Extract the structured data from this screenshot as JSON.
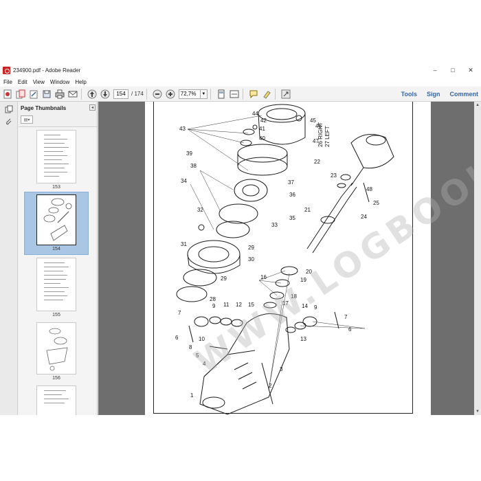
{
  "window": {
    "title": "234900.pdf - Adobe Reader",
    "controls": {
      "minimize": "–",
      "maximize": "□",
      "close": "✕"
    }
  },
  "menu": [
    "File",
    "Edit",
    "View",
    "Window",
    "Help"
  ],
  "toolbar": {
    "page_current": "154",
    "page_total": "/ 174",
    "zoom": "72,7%",
    "tabs": [
      "Tools",
      "Sign",
      "Comment"
    ]
  },
  "sidebar": {
    "title": "Page Thumbnails",
    "thumbnails": [
      {
        "label": "153",
        "selected": false
      },
      {
        "label": "154",
        "selected": true
      },
      {
        "label": "155",
        "selected": false
      },
      {
        "label": "156",
        "selected": false
      }
    ]
  },
  "drawing": {
    "side_labels": [
      "26 RIGHT",
      "27 LEFT"
    ],
    "callouts": [
      "1",
      "2",
      "3",
      "4",
      "5",
      "6",
      "7",
      "8",
      "9",
      "10",
      "11",
      "12",
      "13",
      "14",
      "15",
      "16",
      "17",
      "18",
      "19",
      "20",
      "21",
      "22",
      "23",
      "24",
      "25",
      "26",
      "27",
      "28",
      "29",
      "30",
      "31",
      "32",
      "33",
      "34",
      "35",
      "36",
      "37",
      "38",
      "39",
      "40",
      "41",
      "42",
      "43",
      "44",
      "45",
      "46",
      "47",
      "48"
    ]
  },
  "watermark": "WWW.LOGBOOK.COM",
  "colors": {
    "viewer_bg": "#6e6e6e",
    "sidebar_selected": "#a9c6e4",
    "tab_text": "#3466a8"
  }
}
